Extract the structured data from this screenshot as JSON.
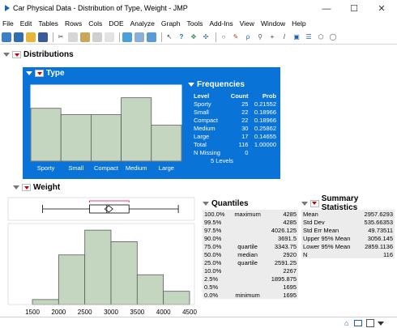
{
  "window": {
    "title": "Car Physical Data - Distribution of Type, Weight - JMP",
    "minimize_glyph": "—",
    "maximize_glyph": "☐",
    "close_glyph": "✕"
  },
  "menu": [
    "File",
    "Edit",
    "Tables",
    "Rows",
    "Cols",
    "DOE",
    "Analyze",
    "Graph",
    "Tools",
    "Add-Ins",
    "View",
    "Window",
    "Help"
  ],
  "toolbar": {
    "icons": [
      "new-data-table-icon",
      "new-script-icon",
      "open-icon",
      "save-icon",
      "cut-icon",
      "copy-icon",
      "paste-icon",
      "copy-image-icon",
      "print-icon",
      "chart-icon",
      "table-icon",
      "chart-builder-icon",
      "arrow-tool-icon",
      "help-tool-icon",
      "selection-tool-icon",
      "scroller-tool-icon",
      "lasso-tool-icon",
      "brush-tool-icon",
      "annotate-tool-icon",
      "magnifier-tool-icon",
      "crosshair-tool-icon",
      "line-tool-icon",
      "simple-shape-icon",
      "polygon-icon",
      "shape-icon",
      "oval-icon"
    ]
  },
  "report": {
    "distributions_title": "Distributions",
    "type": {
      "title": "Type",
      "frequencies_title": "Frequencies",
      "headers": [
        "Level",
        "Count",
        "Prob"
      ],
      "rows": [
        {
          "level": "Sporty",
          "count": "25",
          "prob": "0.21552"
        },
        {
          "level": "Small",
          "count": "22",
          "prob": "0.18966"
        },
        {
          "level": "Compact",
          "count": "22",
          "prob": "0.18966"
        },
        {
          "level": "Medium",
          "count": "30",
          "prob": "0.25862"
        },
        {
          "level": "Large",
          "count": "17",
          "prob": "0.14655"
        },
        {
          "level": "Total",
          "count": "116",
          "prob": "1.00000"
        }
      ],
      "n_missing_label": "N Missing",
      "n_missing_value": "0",
      "levels_text": "5 Levels"
    },
    "weight": {
      "title": "Weight",
      "quantiles_title": "Quantiles",
      "quantiles": [
        {
          "pct": "100.0%",
          "label": "maximum",
          "value": "4285"
        },
        {
          "pct": "99.5%",
          "label": "",
          "value": "4285"
        },
        {
          "pct": "97.5%",
          "label": "",
          "value": "4026.125"
        },
        {
          "pct": "90.0%",
          "label": "",
          "value": "3691.5"
        },
        {
          "pct": "75.0%",
          "label": "quartile",
          "value": "3343.75"
        },
        {
          "pct": "50.0%",
          "label": "median",
          "value": "2920"
        },
        {
          "pct": "25.0%",
          "label": "quartile",
          "value": "2591.25"
        },
        {
          "pct": "10.0%",
          "label": "",
          "value": "2267"
        },
        {
          "pct": "2.5%",
          "label": "",
          "value": "1895.875"
        },
        {
          "pct": "0.5%",
          "label": "",
          "value": "1695"
        },
        {
          "pct": "0.0%",
          "label": "minimum",
          "value": "1695"
        }
      ],
      "summary_title": "Summary Statistics",
      "summary": [
        {
          "name": "Mean",
          "value": "2957.6293"
        },
        {
          "name": "Std Dev",
          "value": "535.66353"
        },
        {
          "name": "Std Err Mean",
          "value": "49.73511"
        },
        {
          "name": "Upper 95% Mean",
          "value": "3056.145"
        },
        {
          "name": "Lower 95% Mean",
          "value": "2859.1136"
        },
        {
          "name": "N",
          "value": "116"
        }
      ]
    }
  },
  "colors": {
    "bar_fill": "#c4d6c0",
    "bar_stroke": "#5a5a5a",
    "type_panel_bg": "#0a73d8",
    "mean_bracket": "#e0005a"
  },
  "chart_data": [
    {
      "type": "bar",
      "categories": [
        "Sporty",
        "Small",
        "Compact",
        "Medium",
        "Large"
      ],
      "values": [
        25,
        22,
        22,
        30,
        17
      ],
      "grid": false
    },
    {
      "type": "bar",
      "categories": [
        "1500-2000",
        "2000-2500",
        "2500-3000",
        "3000-3500",
        "3500-4000",
        "4000-4500"
      ],
      "values": [
        3,
        30,
        45,
        38,
        18,
        8
      ],
      "xlim": [
        1500,
        4500
      ],
      "xticks": [
        1500,
        2000,
        2500,
        3000,
        3500,
        4000,
        4500
      ],
      "box": {
        "min": 1695,
        "q1": 2591.25,
        "median": 2920,
        "q3": 3343.75,
        "max": 4285,
        "mean": 2957.6293
      },
      "grid": false
    }
  ]
}
